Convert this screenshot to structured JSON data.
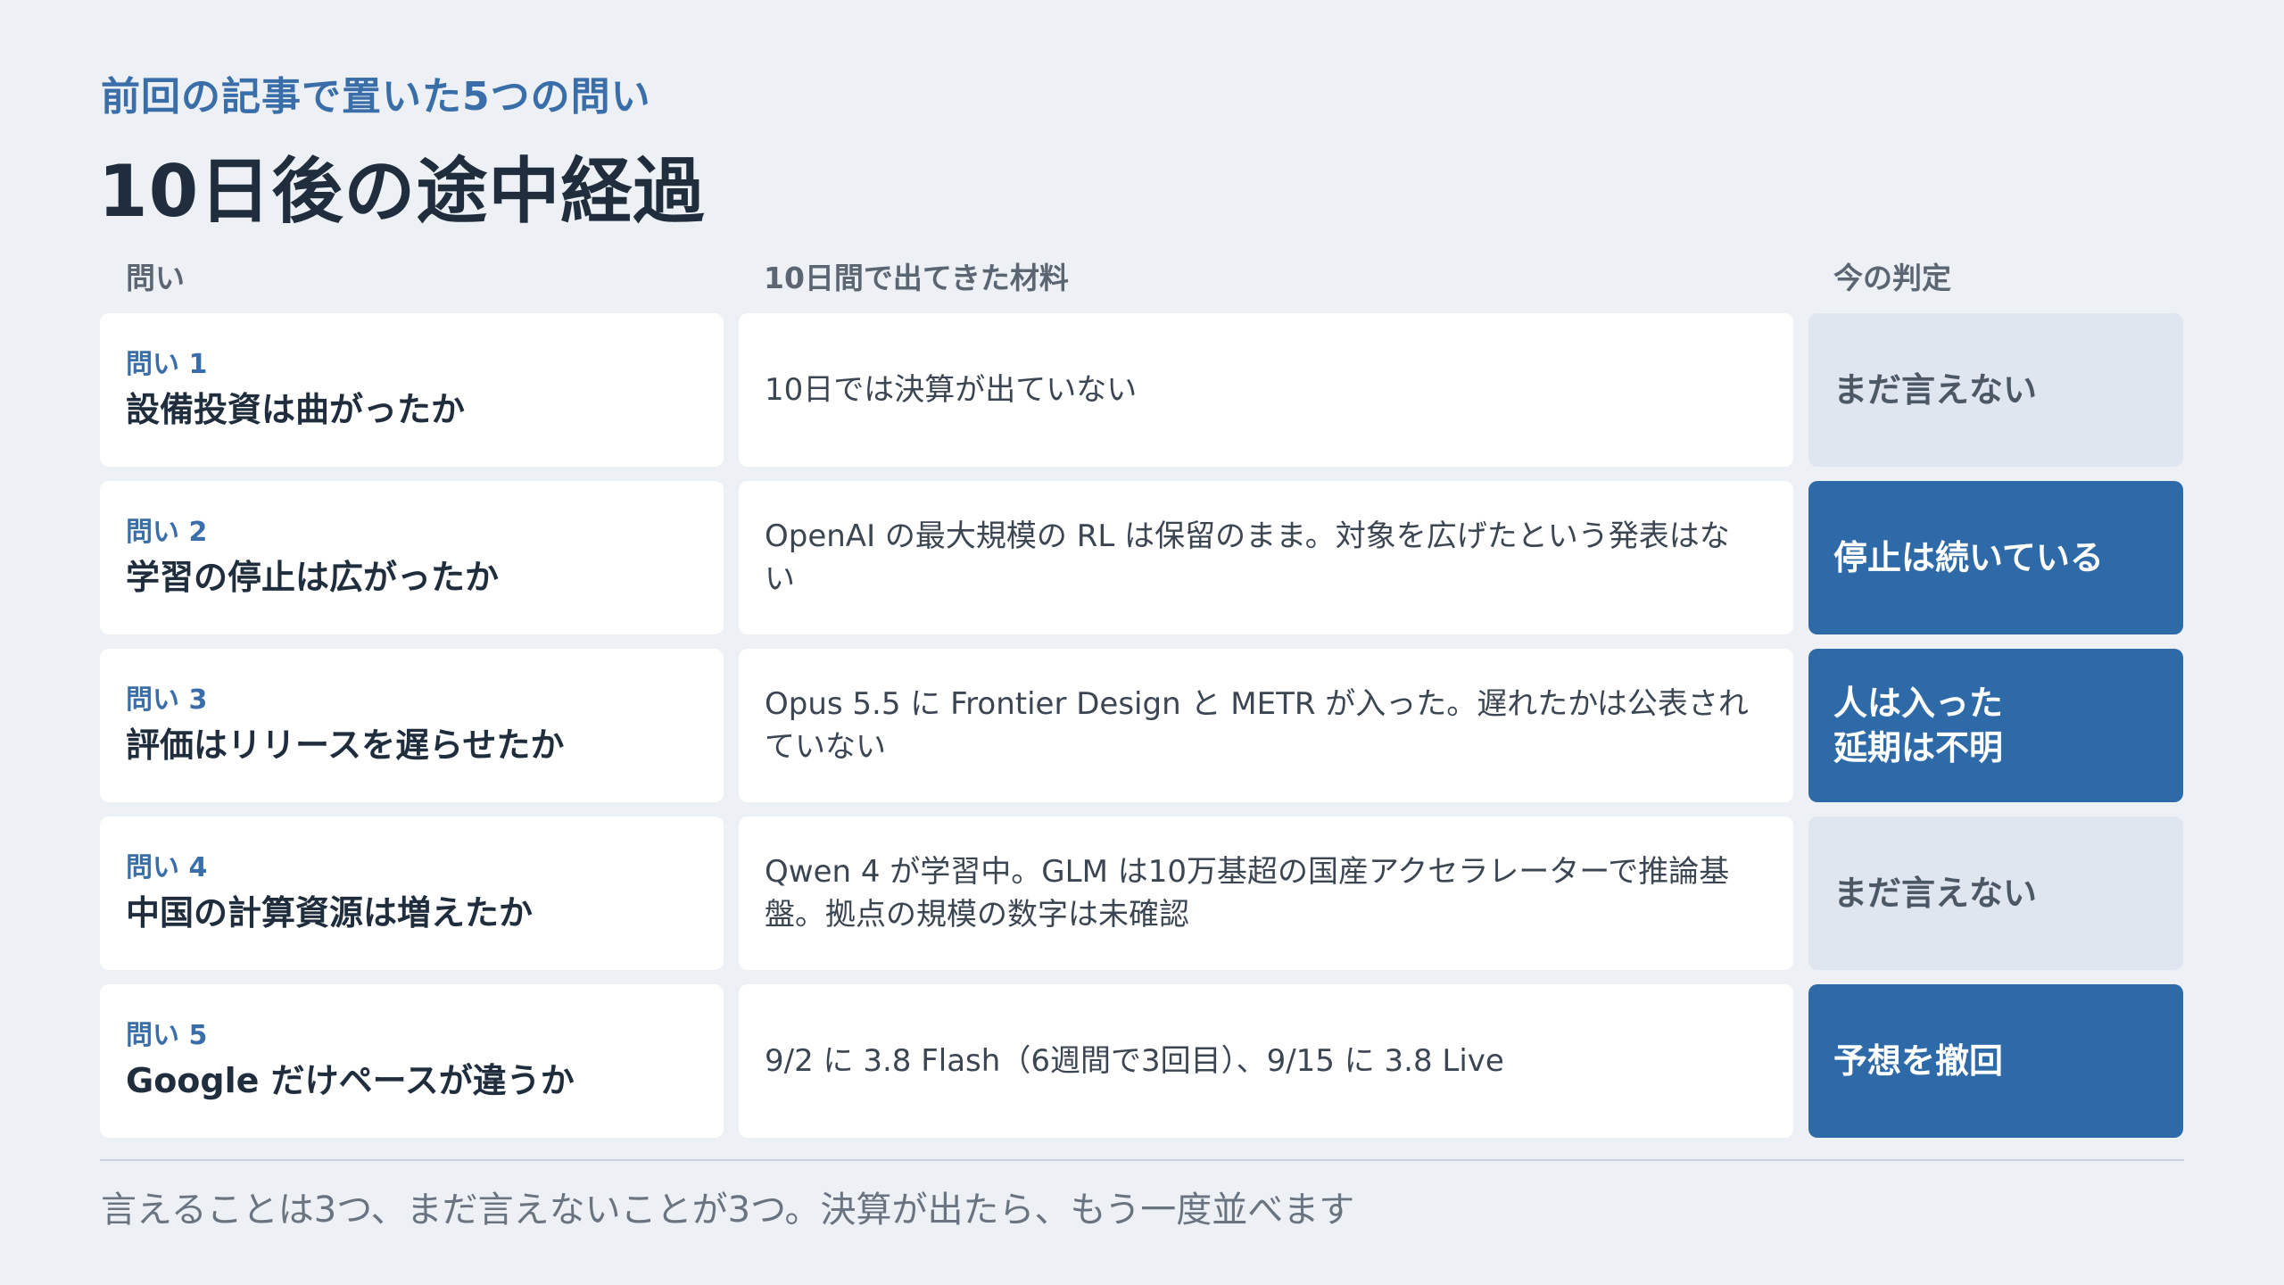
{
  "header": {
    "subtitle": "前回の記事で置いた5つの問い",
    "title": "10日後の途中経過"
  },
  "columns": {
    "question": "問い",
    "material": "10日間で出てきた材料",
    "verdict": "今の判定"
  },
  "rows": [
    {
      "num": "問い 1",
      "question": "設備投資は曲がったか",
      "material": "10日では決算が出ていない",
      "verdict": "まだ言えない",
      "verdict_style": "muted"
    },
    {
      "num": "問い 2",
      "question": "学習の停止は広がったか",
      "material": "OpenAI の最大規模の RL は保留のまま。対象を広げたという発表はない",
      "verdict": "停止は続いている",
      "verdict_style": "strong"
    },
    {
      "num": "問い 3",
      "question": "評価はリリースを遅らせたか",
      "material": "Opus 5.5 に Frontier Design と METR が入った。遅れたかは公表されていない",
      "verdict": "人は入った\n延期は不明",
      "verdict_style": "strong"
    },
    {
      "num": "問い 4",
      "question": "中国の計算資源は増えたか",
      "material": "Qwen 4 が学習中。GLM は10万基超の国産アクセラレーターで推論基盤。拠点の規模の数字は未確認",
      "verdict": "まだ言えない",
      "verdict_style": "muted"
    },
    {
      "num": "問い 5",
      "question": "Google だけペースが違うか",
      "material": "9/2 に 3.8 Flash（6週間で3回目）、9/15 に 3.8 Live",
      "verdict": "予想を撤回",
      "verdict_style": "strong"
    }
  ],
  "footer": "言えることは3つ、まだ言えないことが3つ。決算が出たら、もう一度並べます",
  "colors": {
    "background": "#edf1f6",
    "accent": "#2f6aa8",
    "muted_fill": "#e0e6ef"
  }
}
